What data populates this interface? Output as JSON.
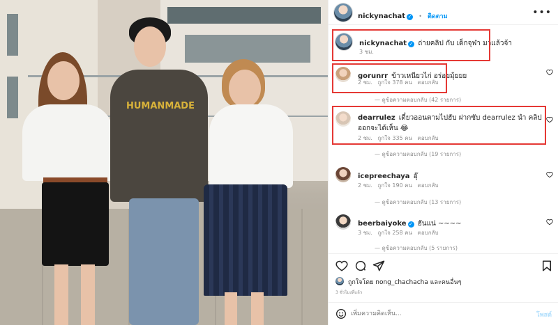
{
  "post": {
    "author": "nickynachat",
    "follow_label": "ติดตาม",
    "caption": "ถ่ายคลิป กับ เด็กจุฬา มาแล้วจ้า",
    "caption_time": "3 ชม.",
    "shirt_text": "HUMANMADE"
  },
  "comments": [
    {
      "user": "gorunrr",
      "text": "ข้าวเหนียวไก่ อร่อยมุ้ยยย",
      "time": "2 ชม.",
      "likes": "ถูกใจ 378 คน",
      "reply": "ตอบกลับ",
      "view_replies": "ดูข้อความตอบกลับ (42 รายการ)"
    },
    {
      "user": "dearrulez",
      "text": "เดี๋ยวออนตามไปฮับ ฝากซับ dearrulez นำ คลิปออกจะได้เห็น 😂",
      "time": "2 ชม.",
      "likes": "ถูกใจ 335 คน",
      "reply": "ตอบกลับ",
      "view_replies": "ดูข้อความตอบกลับ (19 รายการ)"
    },
    {
      "user": "icepreechaya",
      "text": "อุ๊",
      "time": "2 ชม.",
      "likes": "ถูกใจ 190 คน",
      "reply": "ตอบกลับ",
      "view_replies": "ดูข้อความตอบกลับ (13 รายการ)"
    },
    {
      "user": "beerbaiyoke",
      "text": "ฮันแน่ ~~~~",
      "time": "3 ชม.",
      "likes": "ถูกใจ 258 คน",
      "reply": "ตอบกลับ",
      "view_replies": "ดูข้อความตอบกลับ (5 รายการ)"
    }
  ],
  "liked_by": "ถูกใจโดย nong_chachacha และคนอื่นๆ",
  "posted_ago": "3 ชั่วโมงที่แล้ว",
  "comment_input": {
    "placeholder": "เพิ่มความคิดเห็น...",
    "post_label": "โพสต์"
  },
  "icons": [
    "more-icon",
    "heart-icon",
    "comment-icon",
    "share-icon",
    "bookmark-icon",
    "emoji-icon",
    "verified-icon"
  ],
  "colors": {
    "accent": "#0095f6",
    "highlight": "#e53935",
    "muted": "#8e8e8e"
  }
}
